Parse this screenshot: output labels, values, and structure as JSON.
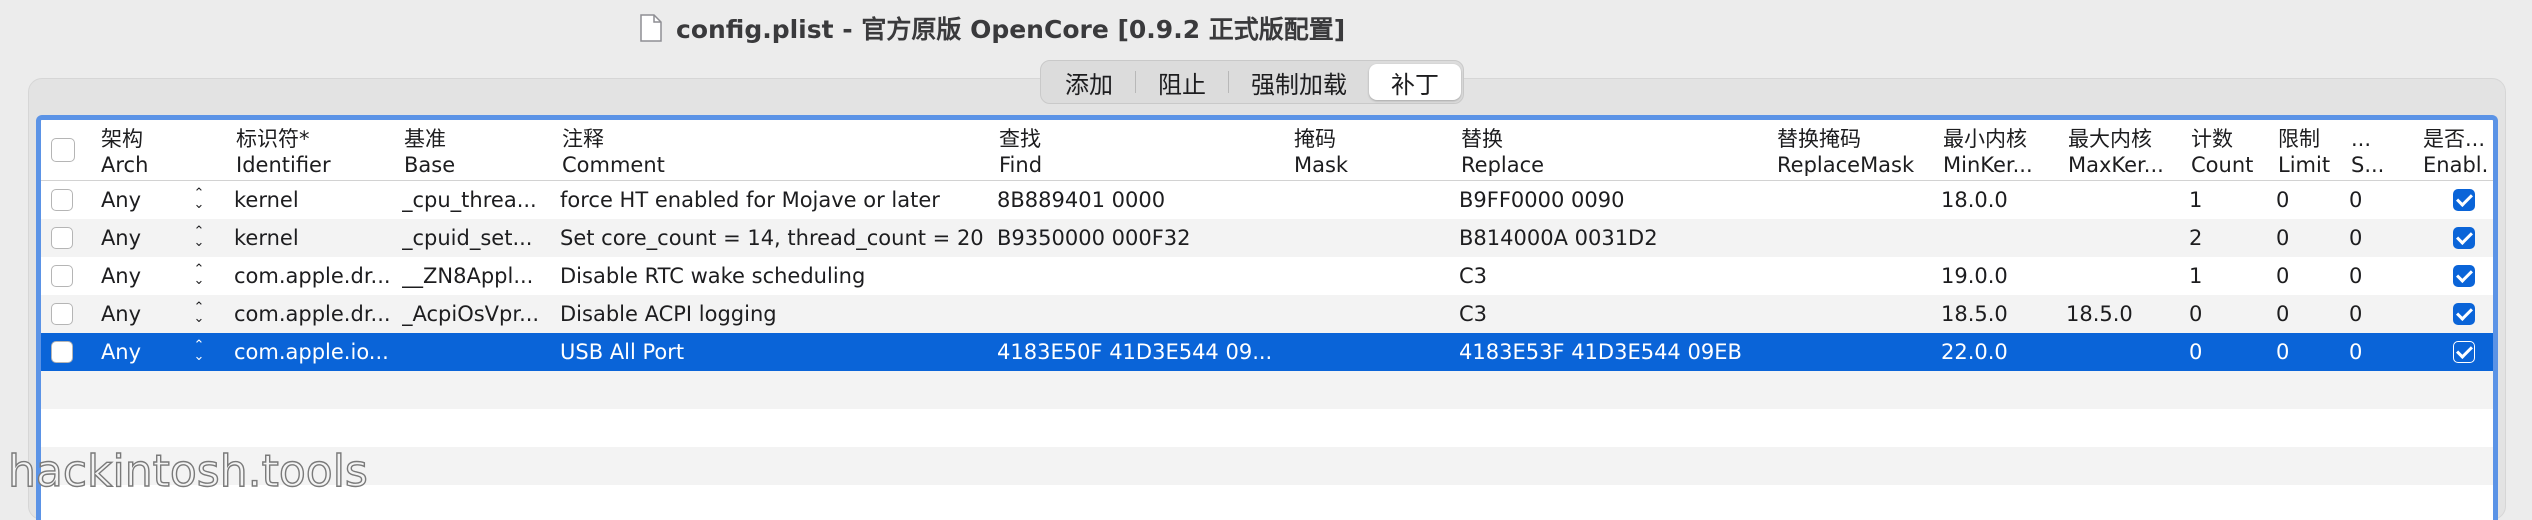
{
  "window": {
    "title": "config.plist - 官方原版 OpenCore [0.9.2 正式版配置]"
  },
  "tabs": [
    {
      "label": "添加",
      "active": false
    },
    {
      "label": "阻止",
      "active": false
    },
    {
      "label": "强制加载",
      "active": false
    },
    {
      "label": "补丁",
      "active": true
    }
  ],
  "table": {
    "headers": [
      {
        "zh": "架构",
        "en": "Arch"
      },
      {
        "zh": "标识符*",
        "en": "Identifier"
      },
      {
        "zh": "基准",
        "en": "Base"
      },
      {
        "zh": "注释",
        "en": "Comment"
      },
      {
        "zh": "查找",
        "en": "Find"
      },
      {
        "zh": "掩码",
        "en": "Mask"
      },
      {
        "zh": "替换",
        "en": "Replace"
      },
      {
        "zh": "替换掩码",
        "en": "ReplaceMask"
      },
      {
        "zh": "最小内核",
        "en": "MinKer..."
      },
      {
        "zh": "最大内核",
        "en": "MaxKer..."
      },
      {
        "zh": "计数",
        "en": "Count"
      },
      {
        "zh": "限制",
        "en": "Limit"
      },
      {
        "zh": "...",
        "en": "S..."
      },
      {
        "zh": "是否...",
        "en": "Enabl..."
      }
    ],
    "rows": [
      {
        "arch": "Any",
        "identifier": "kernel",
        "base": "_cpu_threa...",
        "comment": "force HT enabled for Mojave or later",
        "find": "8B889401 0000",
        "mask": "",
        "replace": "B9FF0000 0090",
        "replacemask": "",
        "minkernel": "18.0.0",
        "maxkernel": "",
        "count": "1",
        "limit": "0",
        "skip": "0",
        "enabled": true,
        "selected": false
      },
      {
        "arch": "Any",
        "identifier": "kernel",
        "base": "_cpuid_set...",
        "comment": "Set core_count = 14, thread_count = 20",
        "find": "B9350000 000F32",
        "mask": "",
        "replace": "B814000A 0031D2",
        "replacemask": "",
        "minkernel": "",
        "maxkernel": "",
        "count": "2",
        "limit": "0",
        "skip": "0",
        "enabled": true,
        "selected": false
      },
      {
        "arch": "Any",
        "identifier": "com.apple.dr...",
        "base": "__ZN8Appl...",
        "comment": "Disable RTC wake scheduling",
        "find": "",
        "mask": "",
        "replace": "C3",
        "replacemask": "",
        "minkernel": "19.0.0",
        "maxkernel": "",
        "count": "1",
        "limit": "0",
        "skip": "0",
        "enabled": true,
        "selected": false
      },
      {
        "arch": "Any",
        "identifier": "com.apple.dr...",
        "base": "_AcpiOsVpr...",
        "comment": "Disable ACPI logging",
        "find": "",
        "mask": "",
        "replace": "C3",
        "replacemask": "",
        "minkernel": "18.5.0",
        "maxkernel": "18.5.0",
        "count": "0",
        "limit": "0",
        "skip": "0",
        "enabled": true,
        "selected": false
      },
      {
        "arch": "Any",
        "identifier": "com.apple.io...",
        "base": "",
        "comment": "USB All Port",
        "find": "4183E50F 41D3E544 09...",
        "mask": "",
        "replace": "4183E53F 41D3E544 09EB",
        "replacemask": "",
        "minkernel": "22.0.0",
        "maxkernel": "",
        "count": "0",
        "limit": "0",
        "skip": "0",
        "enabled": true,
        "selected": true
      }
    ],
    "empty_rows": 4
  },
  "watermark": "hackintosh.tools",
  "colors": {
    "selection": "#0a64d8",
    "focus_ring": "#5b93e6",
    "alt_row": "#f3f3f3"
  }
}
